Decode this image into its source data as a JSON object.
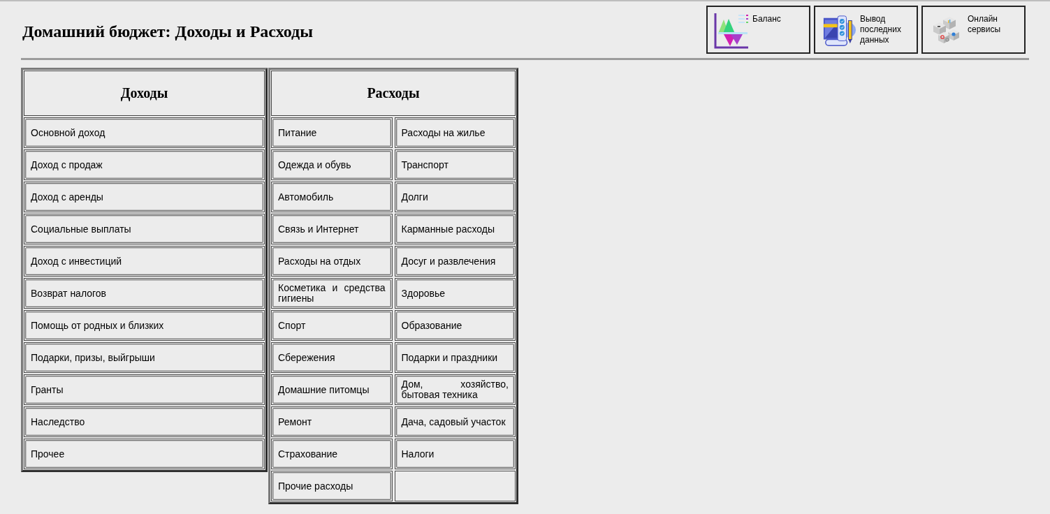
{
  "header": {
    "title": "Домашний бюджет: Доходы и Расходы"
  },
  "toolbar": [
    {
      "kind": "chart",
      "label": "Баланс"
    },
    {
      "kind": "checklist",
      "label": "Вывод последних данных"
    },
    {
      "kind": "cubes",
      "label": "Онлайн сервисы"
    }
  ],
  "income": {
    "heading": "Доходы",
    "items": [
      "Основной доход",
      "Доход с продаж",
      "Доход с аренды",
      "Социальные выплаты",
      "Доход с инвестиций",
      "Возврат налогов",
      "Помощь от родных и близких",
      "Подарки, призы, выйгрыши",
      "Гранты",
      "Наследство",
      "Прочее"
    ]
  },
  "expenses": {
    "heading": "Расходы",
    "rows": [
      [
        "Питание",
        "Расходы на жилье"
      ],
      [
        "Одежда и обувь",
        "Транспорт"
      ],
      [
        "Автомобиль",
        "Долги"
      ],
      [
        "Связь и Интернет",
        "Карманные расходы"
      ],
      [
        "Расходы на отдых",
        "Досуг и развлечения"
      ],
      [
        "Косметика и средства гигиены",
        "Здоровье"
      ],
      [
        "Спорт",
        "Образование"
      ],
      [
        "Сбережения",
        "Подарки и праздники"
      ],
      [
        "Домашние питомцы",
        "Дом, хозяйство, бытовая техника"
      ],
      [
        "Ремонт",
        "Дача, садовый участок"
      ],
      [
        "Страхование",
        "Налоги"
      ],
      [
        "Прочие расходы"
      ]
    ]
  }
}
